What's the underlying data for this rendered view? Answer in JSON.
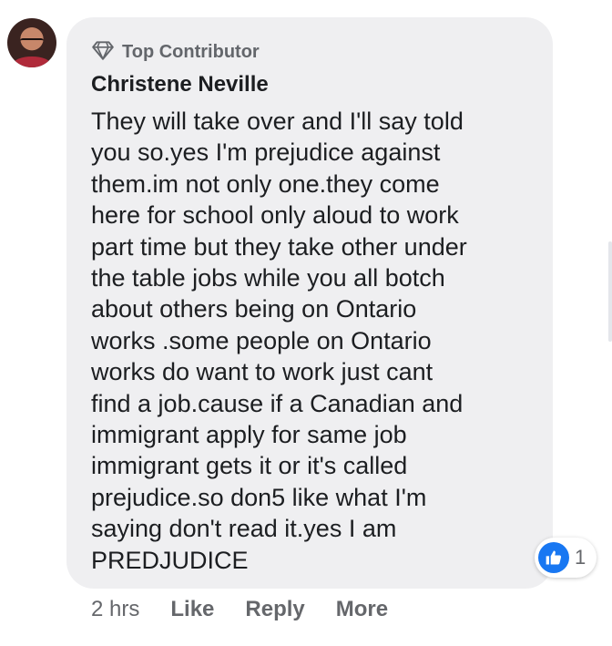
{
  "comment": {
    "author": "Christene Neville",
    "badge": {
      "icon": "diamond-icon",
      "label": "Top Contributor"
    },
    "avatar": "avatar-photo",
    "lines": [
      "They will take over and I'll say told",
      "you so.yes I'm prejudice against",
      "them.im not only one.they come",
      "here for school only aloud to work",
      "part time but they take other under",
      "the table jobs while you all botch",
      "about others being on Ontario",
      "works .some people on Ontario",
      "works do want to work just cant",
      "find a job.cause if a Canadian and",
      "immigrant apply for same job",
      "immigrant gets it or it's called",
      "prejudice.so don5 like what I'm",
      "saying don't read it.yes I am",
      "PREDJUDICE"
    ],
    "reactions": {
      "icon": "thumbs-up-icon",
      "count": "1"
    },
    "actions": {
      "time": "2 hrs",
      "like": "Like",
      "reply": "Reply",
      "more": "More"
    }
  },
  "colors": {
    "bubble": "#efeff1",
    "like_blue": "#1877f2",
    "secondary_text": "#65676b",
    "primary_text": "#1c1e21"
  }
}
